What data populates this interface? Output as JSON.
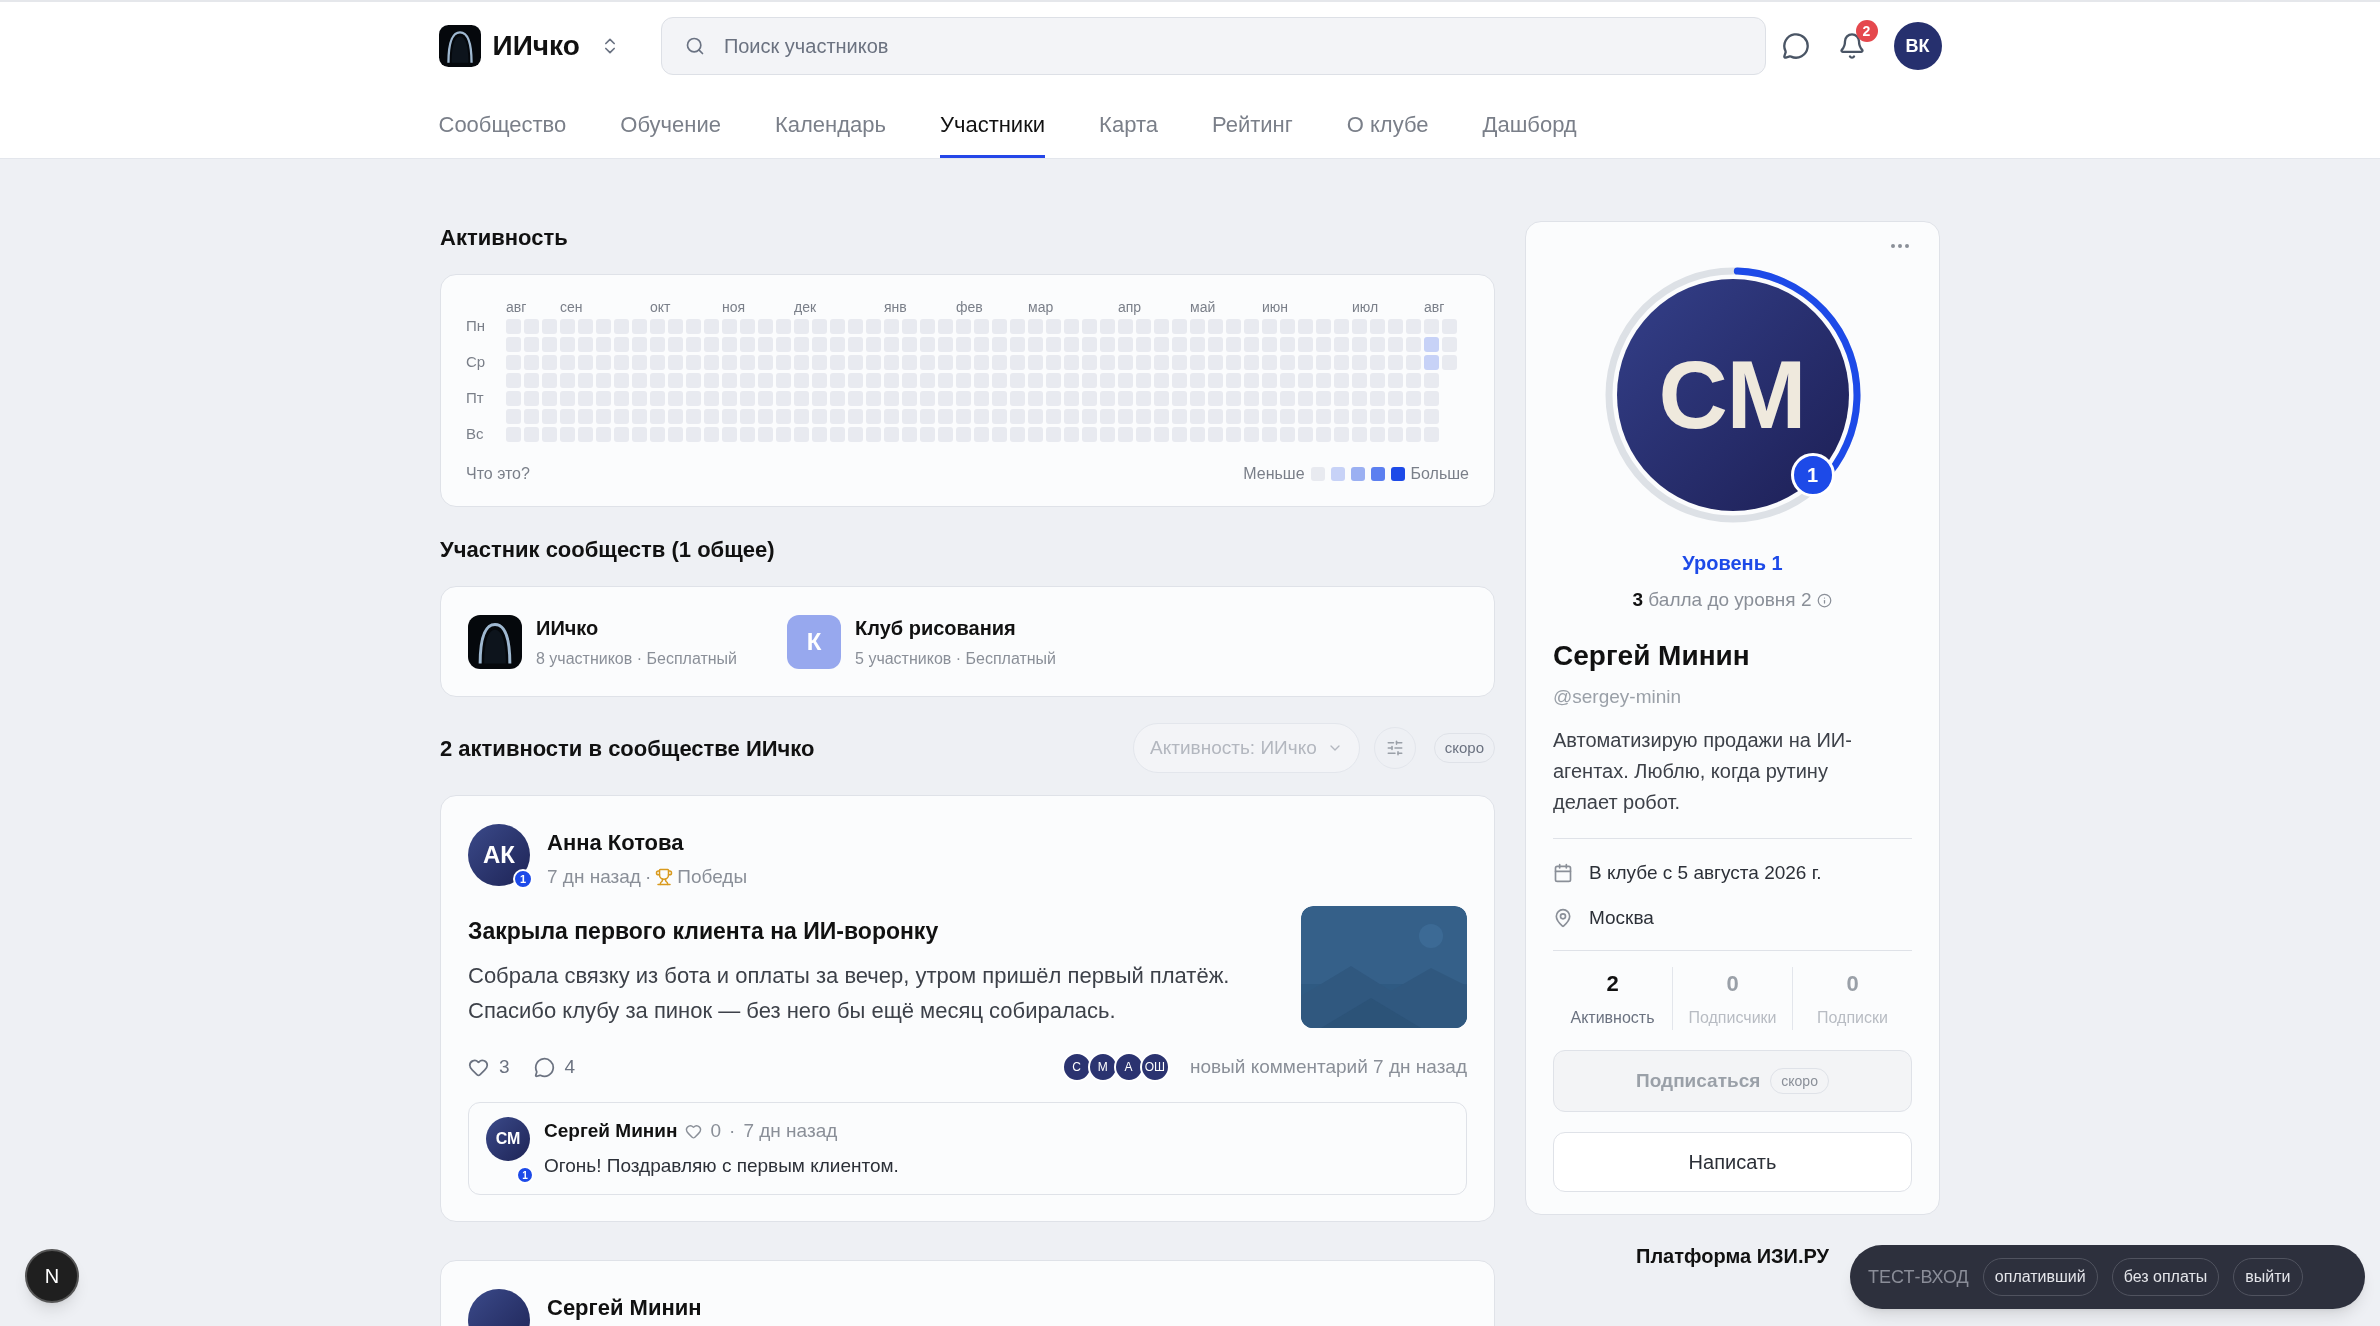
{
  "header": {
    "club_name": "ИИчко",
    "search": {
      "placeholder": "Поиск участников"
    },
    "notifications_count": "2",
    "user_initials": "ВК"
  },
  "tabs": [
    {
      "label": "Сообщество",
      "selected": false
    },
    {
      "label": "Обучение",
      "selected": false
    },
    {
      "label": "Календарь",
      "selected": false
    },
    {
      "label": "Участники",
      "selected": true
    },
    {
      "label": "Карта",
      "selected": false
    },
    {
      "label": "Рейтинг",
      "selected": false
    },
    {
      "label": "О клубе",
      "selected": false
    },
    {
      "label": "Дашборд",
      "selected": false
    }
  ],
  "activity": {
    "title": "Активность",
    "months": [
      "авг",
      "сен",
      "окт",
      "ноя",
      "дек",
      "янв",
      "фев",
      "мар",
      "апр",
      "май",
      "июн",
      "июл",
      "авг"
    ],
    "rows": [
      {
        "label": "Пн",
        "last_week": {
          "color": "#e8eaf0"
        },
        "current_week": {
          "color": "#e8eaf0"
        }
      },
      {
        "last_week": {
          "color": "#c7d2f7"
        },
        "current_week": {
          "color": "#e8eaf0"
        }
      },
      {
        "label": "Ср",
        "last_week": {
          "color": "#c7d2f7"
        },
        "current_week": {
          "color": "#e8eaf0"
        }
      },
      {
        "last_week": {
          "color": "#e8eaf0"
        }
      },
      {
        "label": "Пт",
        "last_week": {
          "color": "#e8eaf0"
        }
      },
      {
        "last_week": {
          "color": "#e8eaf0"
        }
      },
      {
        "label": "Вс",
        "last_week": {
          "color": "#e8eaf0"
        }
      }
    ],
    "help_link": "Что это?",
    "legend": {
      "less": "Меньше",
      "more": "Больше",
      "swatches": [
        {
          "color": "#e8eaf0"
        },
        {
          "color": "#c7d2f7"
        },
        {
          "color": "#9bb0f2"
        },
        {
          "color": "#5c7ff0"
        },
        {
          "color": "#1d4ae8"
        }
      ]
    }
  },
  "communities": {
    "title": "Участник сообществ (1 общее)",
    "items": [
      {
        "kind": "logo",
        "name": "ИИчко",
        "meta": "8 участников · Бесплатный"
      },
      {
        "kind": "letter",
        "letter": "К",
        "name": "Клуб рисования",
        "meta": "5 участников · Бесплатный"
      }
    ]
  },
  "feed": {
    "title": "2 активности в сообществе ИИчко",
    "filter": "Активность: ИИчко",
    "soon_badge": "скоро",
    "posts": [
      {
        "author": "Анна Котова",
        "initials": "АК",
        "level": "1",
        "time": "7 дн назад",
        "separator": "·",
        "category": "Победы",
        "title": "Закрыла первого клиента на ИИ-воронку",
        "body": "Собрала связку из бота и оплаты за вечер, утром пришёл первый платёж. Спасибо клубу за пинок — без него бы ещё месяц собиралась.",
        "likes": "3",
        "comments": "4",
        "commenters": [
          "С",
          "М",
          "А",
          "ОШ"
        ],
        "last_comment": "новый комментарий 7 дн назад",
        "comment": {
          "author": "Сергей Минин",
          "initials": "СМ",
          "level": "1",
          "likes": "0",
          "separator": "·",
          "time": "7 дн назад",
          "text": "Огонь! Поздравляю с первым клиентом."
        }
      },
      {
        "author": "Сергей Минин"
      }
    ]
  },
  "profile": {
    "initials": "СМ",
    "level_badge": "1",
    "progress": {
      "level": 0.37
    },
    "level_label": "Уровень 1",
    "points": "3",
    "points_text": "балла до уровня 2",
    "name": "Сергей Минин",
    "handle": "@sergey-minin",
    "bio": "Автоматизирую продажи на ИИ-агентах. Люблю, когда рутину делает робот.",
    "joined": "В клубе с 5 августа 2026 г.",
    "city": "Москва",
    "stats": [
      {
        "value": "2",
        "label": "Активность",
        "disabled": false
      },
      {
        "value": "0",
        "label": "Подписчики",
        "disabled": true
      },
      {
        "value": "0",
        "label": "Подписки",
        "disabled": true
      }
    ],
    "subscribe": {
      "label": "Подписаться",
      "badge": "скоро",
      "disabled": true
    },
    "message": {
      "label": "Написать",
      "disabled": false
    }
  },
  "footer": {
    "platform": "Платформа ИЗИ.РУ"
  },
  "test_bar": {
    "label": "ТЕСТ-ВХОД",
    "buttons": [
      "оплативший",
      "без оплаты",
      "выйти"
    ]
  },
  "dev_badge": "N"
}
